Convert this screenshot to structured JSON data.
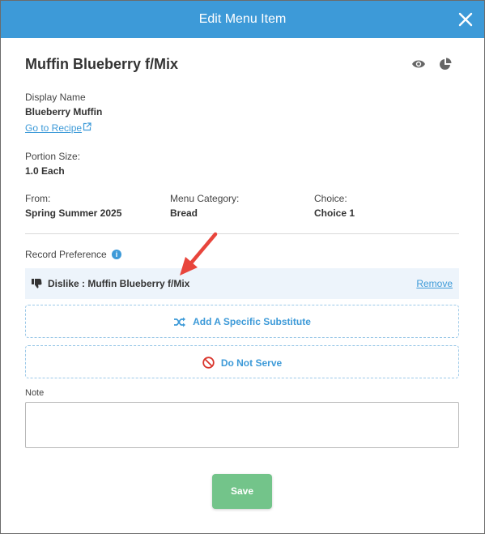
{
  "modal": {
    "title": "Edit Menu Item"
  },
  "item": {
    "name": "Muffin Blueberry f/Mix",
    "display_name_label": "Display Name",
    "display_name": "Blueberry Muffin",
    "recipe_link": "Go to Recipe",
    "portion_label": "Portion Size:",
    "portion_value": "1.0 Each",
    "from_label": "From:",
    "from_value": "Spring Summer 2025",
    "category_label": "Menu Category:",
    "category_value": "Bread",
    "choice_label": "Choice:",
    "choice_value": "Choice 1"
  },
  "preference": {
    "label": "Record Preference",
    "info_glyph": "i",
    "entry": "Dislike : Muffin Blueberry f/Mix",
    "remove_label": "Remove",
    "add_substitute_label": "Add A Specific Substitute",
    "do_not_serve_label": "Do Not Serve"
  },
  "note": {
    "label": "Note",
    "value": ""
  },
  "actions": {
    "save_label": "Save"
  },
  "colors": {
    "header": "#3d9ad8",
    "accent": "#3d9ad8",
    "danger": "#d9342b",
    "save": "#73c48a",
    "annotation_arrow": "#e8453c"
  }
}
